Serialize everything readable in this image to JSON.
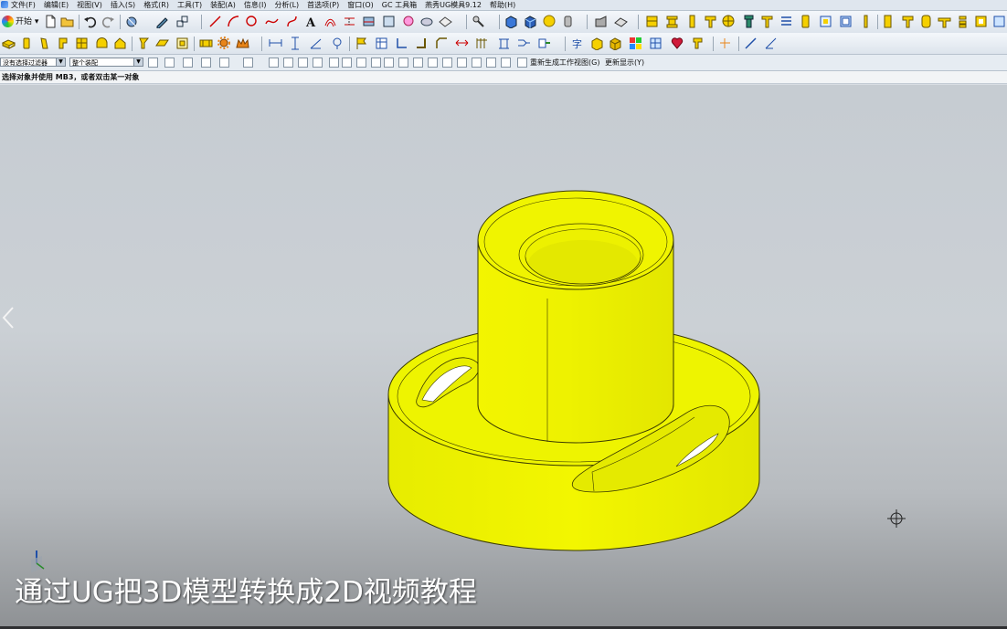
{
  "menu": [
    "文件(F)",
    "编辑(E)",
    "视图(V)",
    "插入(S)",
    "格式(R)",
    "工具(T)",
    "装配(A)",
    "信息(I)",
    "分析(L)",
    "首选项(P)",
    "窗口(O)",
    "GC 工具箱",
    "燕秀UG模具9.12",
    "帮助(H)"
  ],
  "toolbar": {
    "start_label": "开始"
  },
  "selection_bar": {
    "filter_value": "没有选择过滤器",
    "scope_value": "整个装配",
    "regenerate_label": "重新生成工作视图(G)",
    "refresh_label": "更新显示(Y)"
  },
  "cue_line": "选择对象并使用 MB3，或者双击某一对象",
  "viewport": {
    "caption": "通过UG把3D模型转换成2D视频教程",
    "part_color": "#eef000",
    "edge_color": "#3a3a00"
  }
}
